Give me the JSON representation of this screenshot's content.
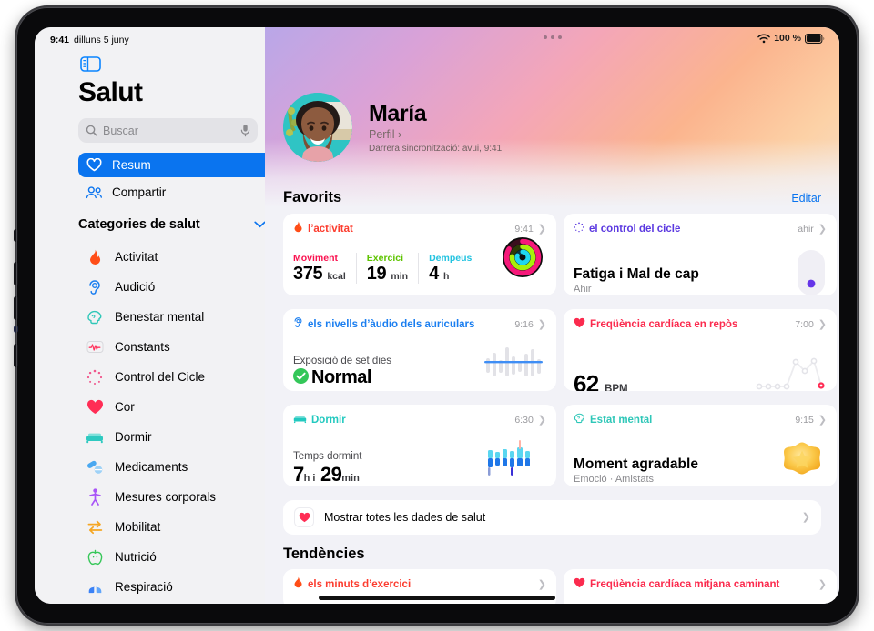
{
  "status_bar": {
    "time": "9:41",
    "date": "dilluns 5 juny",
    "wifi_icon": "wifi-icon",
    "battery_percent": "100 %",
    "battery_icon": "battery-full-icon"
  },
  "sidebar": {
    "toggle_icon": "sidebar-toggle-icon",
    "app_title": "Salut",
    "search": {
      "placeholder": "Buscar",
      "icon": "search-icon",
      "mic_icon": "microphone-icon"
    },
    "nav": [
      {
        "label": "Resum",
        "icon": "heart-outline-icon",
        "selected": true
      },
      {
        "label": "Compartir",
        "icon": "people-icon",
        "selected": false
      }
    ],
    "categories_header": {
      "label": "Categories de salut",
      "chevron_icon": "chevron-down-icon"
    },
    "categories": [
      {
        "label": "Activitat",
        "icon": "flame-icon",
        "color": "#ff5a2a"
      },
      {
        "label": "Audició",
        "icon": "ear-icon",
        "color": "#1a7ef0"
      },
      {
        "label": "Benestar mental",
        "icon": "head-icon",
        "color": "#2fc7b8"
      },
      {
        "label": "Constants",
        "icon": "vitals-icon",
        "color": "#ff375f"
      },
      {
        "label": "Control del Cicle",
        "icon": "cycle-icon",
        "color": "#f06292"
      },
      {
        "label": "Cor",
        "icon": "heart-filled-icon",
        "color": "#ff2d55"
      },
      {
        "label": "Dormir",
        "icon": "bed-icon",
        "color": "#2ec9c0"
      },
      {
        "label": "Medicaments",
        "icon": "pills-icon",
        "color": "#2f9ff0"
      },
      {
        "label": "Mesures corporals",
        "icon": "body-icon",
        "color": "#a855f7"
      },
      {
        "label": "Mobilitat",
        "icon": "mobility-icon",
        "color": "#f5a623"
      },
      {
        "label": "Nutrició",
        "icon": "apple-icon",
        "color": "#37c759"
      },
      {
        "label": "Respiració",
        "icon": "lungs-icon",
        "color": "#2f7ff0"
      }
    ]
  },
  "hero": {
    "grabber_icon": "window-grabber-icon",
    "avatar_alt": "user-avatar",
    "name": "María",
    "profile_link": "Perfil",
    "profile_chevron": "chevron-right-icon",
    "last_sync": "Darrera sincronització: avui, 9:41"
  },
  "favorites": {
    "title": "Favorits",
    "edit_label": "Editar",
    "cards": [
      {
        "id": "activity",
        "title": "l’activitat",
        "title_color": "#fc3c2e",
        "icon": "flame-icon",
        "time": "9:41",
        "metrics": [
          {
            "label": "Moviment",
            "color": "#fa114f",
            "value": "375",
            "unit": "kcal"
          },
          {
            "label": "Exercici",
            "color": "#a2f10c",
            "value": "19",
            "unit": "min"
          },
          {
            "label": "Dempeus",
            "color": "#1fd3e8",
            "value": "4",
            "unit": "h"
          }
        ],
        "visual": "activity-rings"
      },
      {
        "id": "cycle",
        "title": "el control del cicle",
        "title_color": "#5b39e0",
        "icon": "cycle-icon",
        "time": "ahir",
        "headline": "Fatiga i Mal de cap",
        "subtext": "Ahir",
        "visual": "cycle-pill"
      },
      {
        "id": "headphone-audio",
        "title": "els nivells d’àudio dels auriculars",
        "title_color": "#1a7ef0",
        "icon": "ear-icon",
        "time": "9:16",
        "caption": "Exposició de set dies",
        "status_value": "Normal",
        "status_icon": "check-circle-icon",
        "status_icon_color": "#34c759",
        "visual": "audio-bars"
      },
      {
        "id": "resting-heart-rate",
        "title": "Freqüència cardíaca en repòs",
        "title_color": "#fb2b4e",
        "icon": "heart-filled-icon",
        "time": "7:00",
        "value": "62",
        "unit": "BPM",
        "visual": "heart-rate-line"
      },
      {
        "id": "sleep",
        "title": "Dormir",
        "title_color": "#22c9bf",
        "icon": "bed-icon",
        "time": "6:30",
        "caption": "Temps dormint",
        "value_hours": "7",
        "unit_hours": "h i",
        "value_minutes": "29",
        "unit_minutes": "min",
        "visual": "sleep-bars"
      },
      {
        "id": "state-of-mind",
        "title": "Estat mental",
        "title_color": "#2fc7b8",
        "icon": "head-icon",
        "time": "9:15",
        "headline": "Moment agradable",
        "subtext": "Emoció · Amistats",
        "visual": "star-emoji"
      }
    ]
  },
  "show_all": {
    "label": "Mostrar totes les dades de salut",
    "icon": "heart-filled-icon",
    "chevron_icon": "chevron-right-icon"
  },
  "trends": {
    "title": "Tendències",
    "cards": [
      {
        "title": "els minuts d’exercici",
        "title_color": "#fc3c2e",
        "icon": "flame-icon"
      },
      {
        "title": "Freqüència cardíaca mitjana caminant",
        "title_color": "#fb2b4e",
        "icon": "heart-filled-icon"
      }
    ]
  },
  "home_indicator": "home-indicator"
}
